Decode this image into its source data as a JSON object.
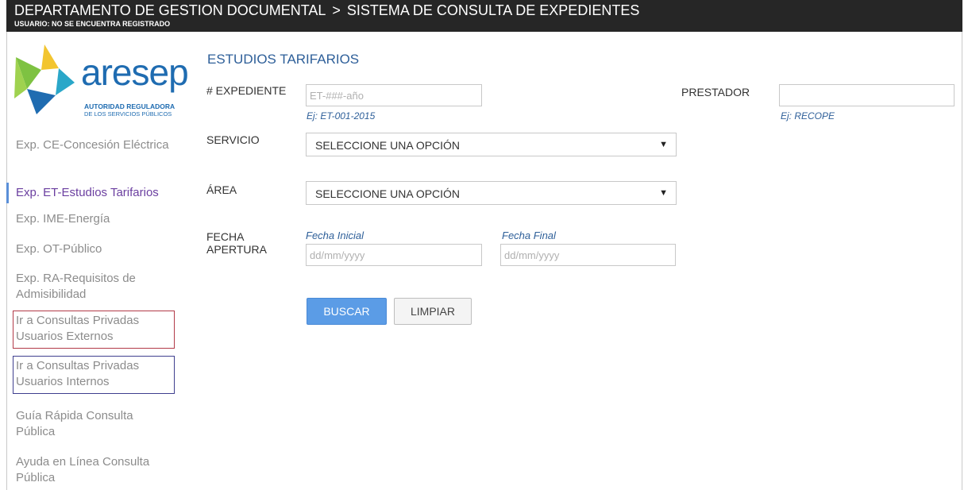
{
  "header": {
    "department": "DEPARTAMENTO DE GESTION DOCUMENTAL",
    "separator": ">",
    "system": "SISTEMA DE CONSULTA DE EXPEDIENTES",
    "user_status": "USUARIO: NO SE ENCUENTRA REGISTRADO"
  },
  "logo": {
    "word": "aresep",
    "tagline_1": "AUTORIDAD REGULADORA",
    "tagline_2": "DE LOS SERVICIOS PÚBLICOS",
    "colors": {
      "blue": "#1f6cb1",
      "green": "#7ec242",
      "yellow": "#f2c530",
      "teal": "#2aa7c9"
    }
  },
  "sidebar": {
    "items": [
      {
        "label": "Exp. CE-Concesión Eléctrica"
      },
      {
        "label": "Exp. ET-Estudios Tarifarios",
        "active": true
      },
      {
        "label": "Exp. IME-Energía"
      },
      {
        "label": "Exp. OT-Público"
      },
      {
        "label": "Exp. RA-Requisitos de Admisibilidad"
      }
    ],
    "private_external": "Ir a Consultas Privadas Usuarios Externos",
    "private_internal": "Ir a Consultas Privadas Usuarios Internos",
    "quick_guide": "Guía Rápida Consulta Pública",
    "online_help": "Ayuda en Línea Consulta Pública"
  },
  "main": {
    "title": "ESTUDIOS TARIFARIOS",
    "expediente": {
      "label": "# EXPEDIENTE",
      "placeholder": "ET-###-año",
      "value": "",
      "hint": "Ej: ET-001-2015"
    },
    "prestador": {
      "label": "PRESTADOR",
      "placeholder": "",
      "value": "",
      "hint": "Ej: RECOPE"
    },
    "servicio": {
      "label": "SERVICIO",
      "selected": "SELECCIONE UNA OPCIÓN"
    },
    "area": {
      "label": "ÁREA",
      "selected": "SELECCIONE UNA OPCIÓN"
    },
    "fecha": {
      "label_1": "FECHA",
      "label_2": "APERTURA",
      "start_label": "Fecha Inicial",
      "start_placeholder": "dd/mm/yyyy",
      "end_label": "Fecha Final",
      "end_placeholder": "dd/mm/yyyy"
    },
    "buttons": {
      "search": "BUSCAR",
      "clear": "LIMPIAR"
    }
  },
  "colors": {
    "header_bg": "#262626",
    "title_blue": "#2e5f99",
    "active_link": "#6b3fa0",
    "primary_button": "#5b9ce6",
    "external_box_border": "#b23a48",
    "internal_box_border": "#3f3f8f"
  }
}
